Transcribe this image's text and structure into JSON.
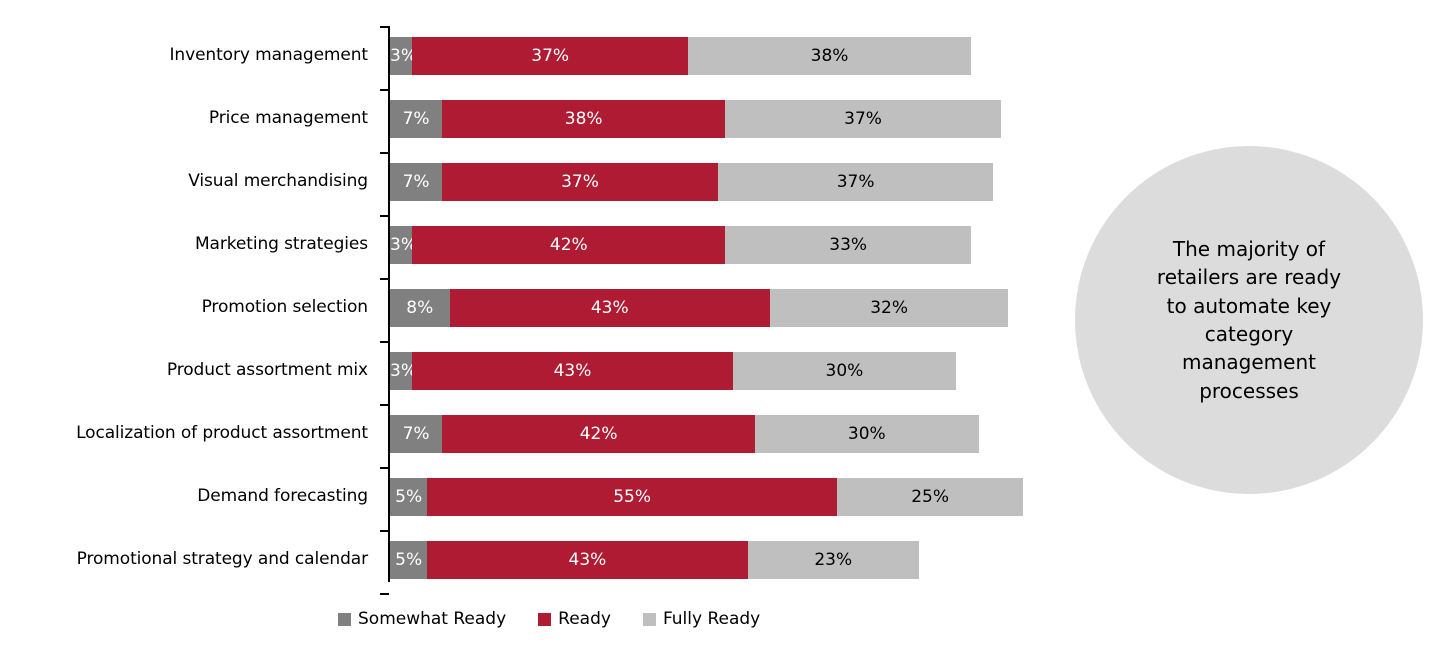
{
  "chart_data": {
    "type": "bar",
    "subtype": "horizontal-stacked-bar",
    "title": "",
    "xlabel": "",
    "ylabel": "",
    "grid": false,
    "legend_position": "bottom",
    "axis_max_percent": 140,
    "value_suffix": "%",
    "categories": [
      "Inventory management",
      "Price management",
      "Visual merchandising",
      "Marketing strategies",
      "Promotion selection",
      "Product assortment mix",
      "Localization of product assortment",
      "Demand forecasting",
      "Promotional strategy and calendar"
    ],
    "series": [
      {
        "name": "Somewhat Ready",
        "color": "#808080",
        "values": [
          3,
          7,
          7,
          3,
          8,
          3,
          7,
          5,
          5
        ],
        "labels": [
          "3%",
          "7%",
          "7%",
          "3%",
          "8%",
          "3%",
          "7%",
          "5%",
          "5%"
        ]
      },
      {
        "name": "Ready",
        "color": "#AF1B33",
        "values": [
          37,
          38,
          37,
          42,
          43,
          43,
          42,
          55,
          43
        ],
        "labels": [
          "37%",
          "38%",
          "37%",
          "42%",
          "43%",
          "43%",
          "42%",
          "55%",
          "43%"
        ]
      },
      {
        "name": "Fully Ready",
        "color": "#BFBFBF",
        "values": [
          38,
          37,
          37,
          33,
          32,
          30,
          30,
          25,
          23
        ],
        "labels": [
          "38%",
          "37%",
          "37%",
          "33%",
          "32%",
          "30%",
          "30%",
          "25%",
          "23%"
        ]
      }
    ]
  },
  "legend": {
    "items": [
      {
        "label": "Somewhat Ready",
        "color": "#808080"
      },
      {
        "label": "Ready",
        "color": "#AF1B33"
      },
      {
        "label": "Fully Ready",
        "color": "#BFBFBF"
      }
    ]
  },
  "callout": {
    "text": "The majority of retailers are ready to automate key category management processes",
    "background_color": "#DCDCDC"
  }
}
